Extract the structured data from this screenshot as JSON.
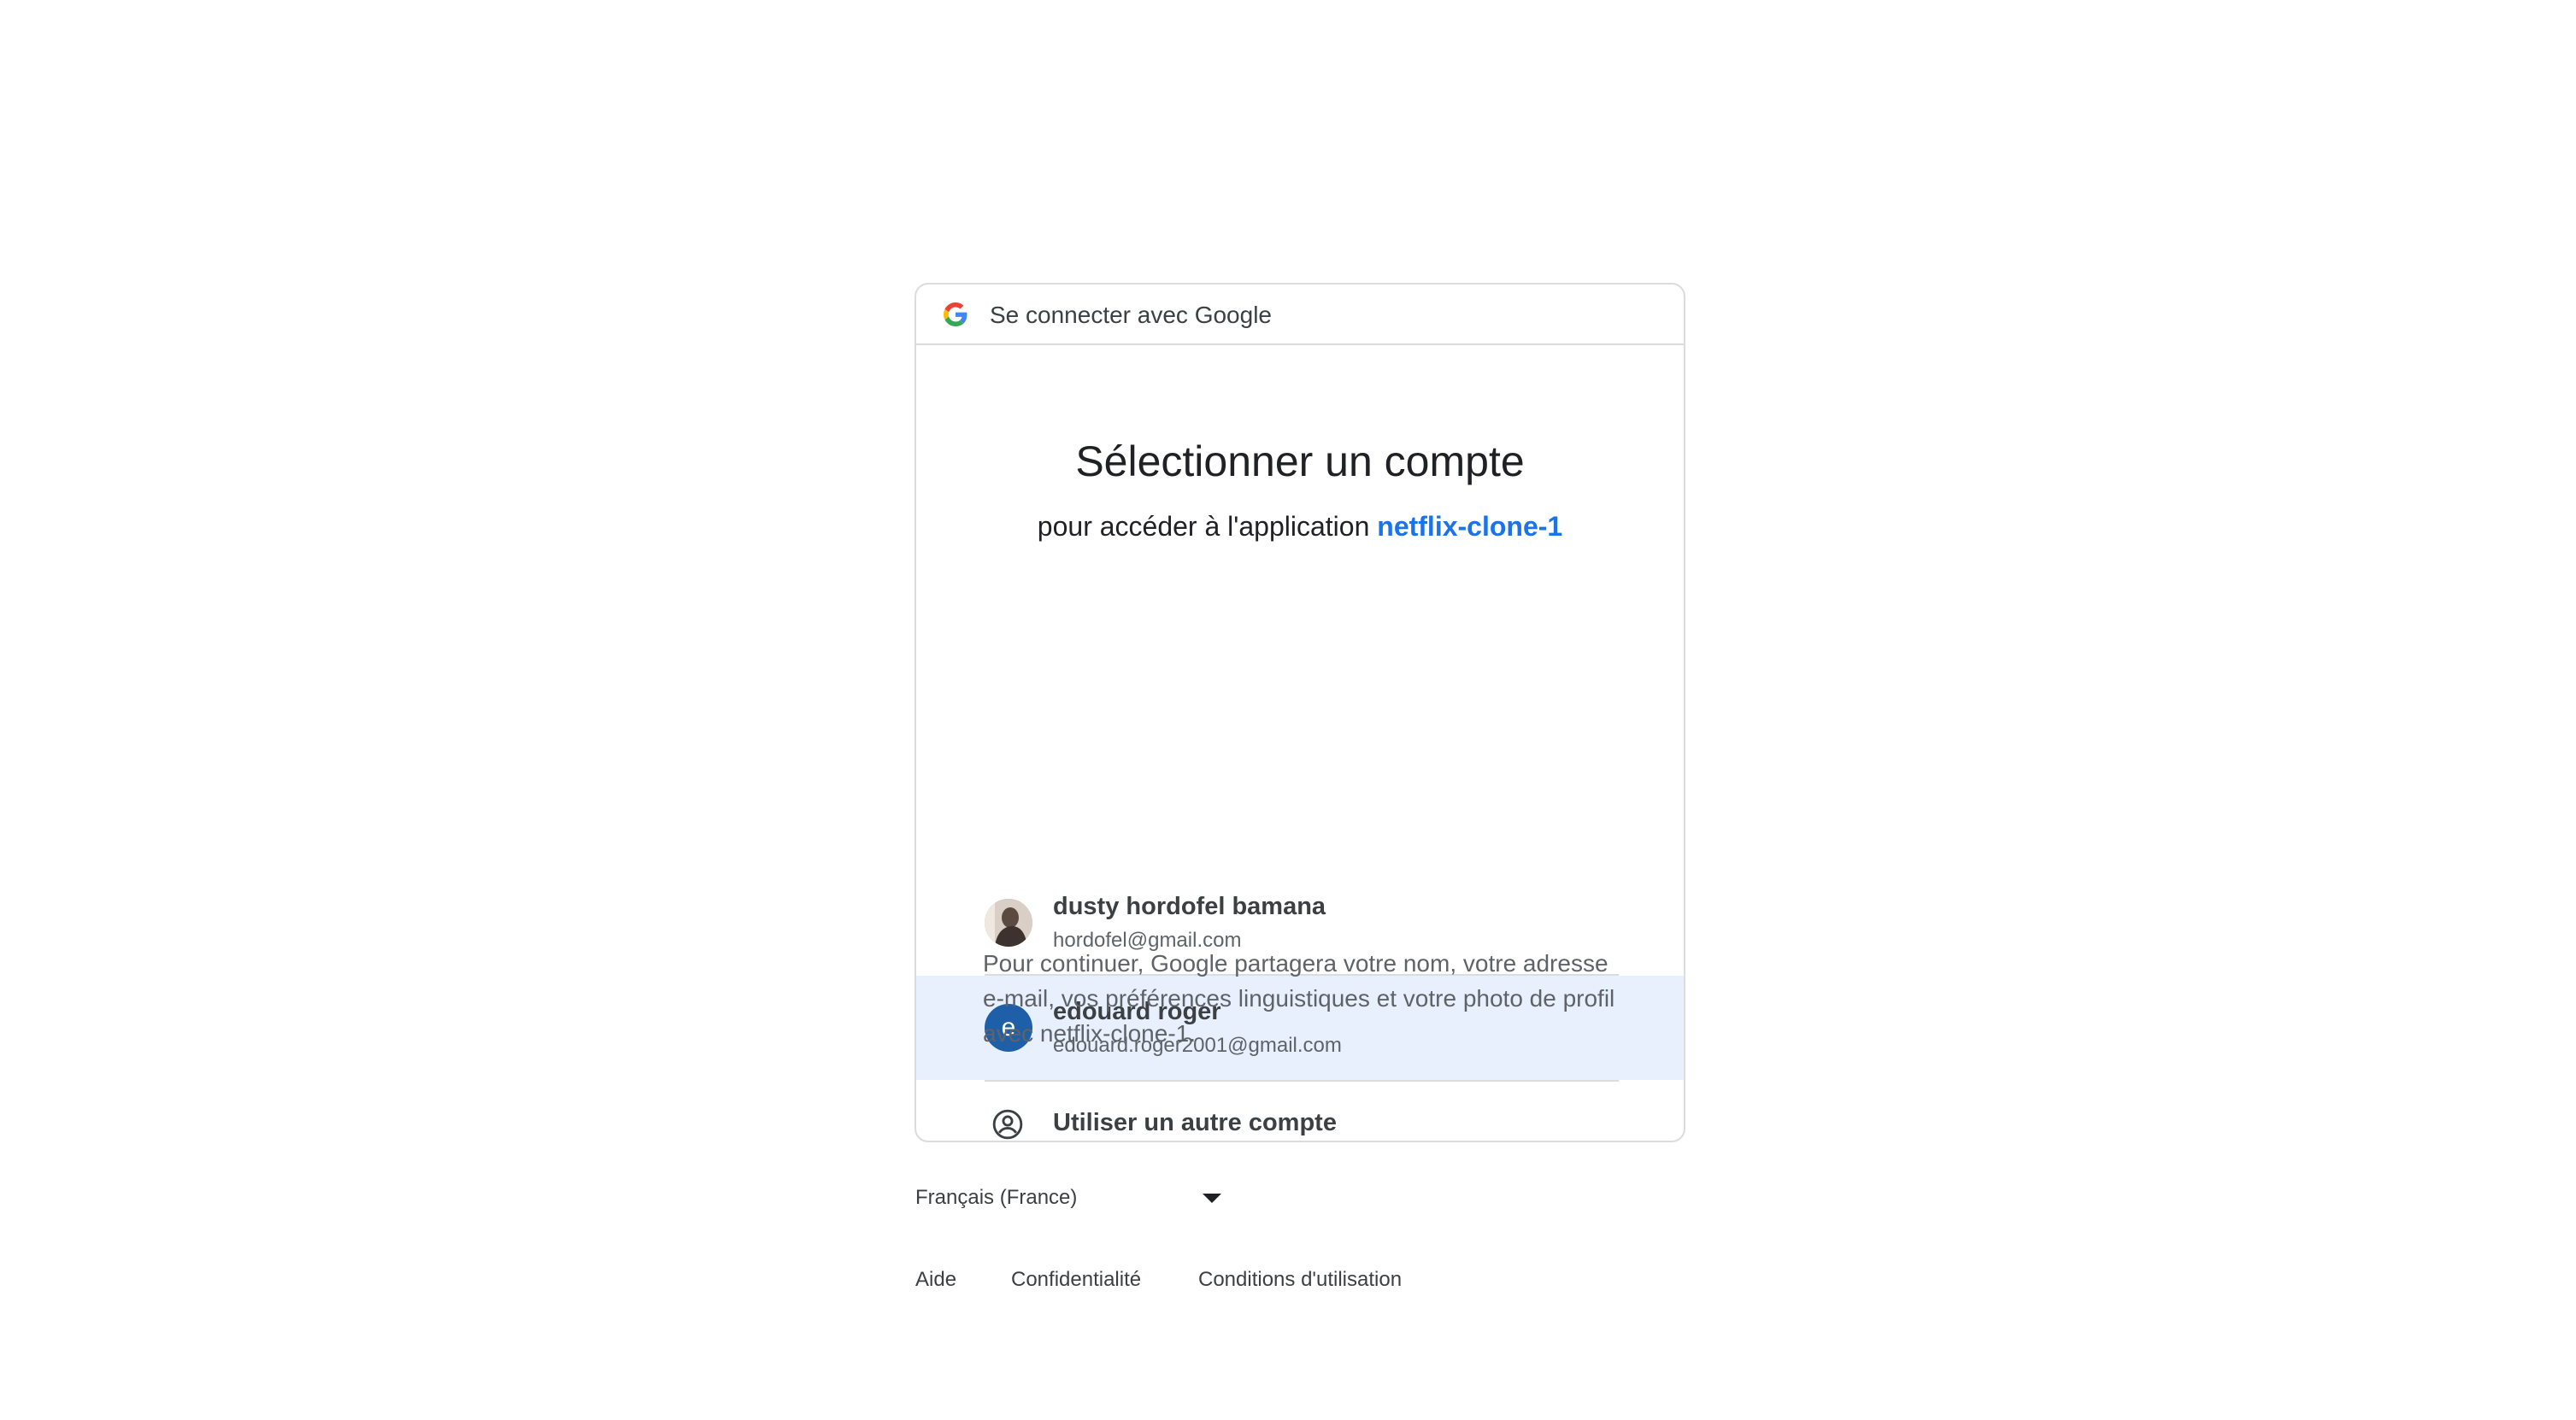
{
  "header": {
    "text": "Se connecter avec Google",
    "logo": "google-g-icon"
  },
  "title": "Sélectionner un compte",
  "subtitle": {
    "prefix": "pour accéder à l'application ",
    "app_name": "netflix-clone-1"
  },
  "accounts": [
    {
      "name": "dusty hordofel bamana",
      "email": "hordofel@gmail.com",
      "avatar": "photo",
      "selected": false
    },
    {
      "name": "edouard roger",
      "email": "edouard.roger2001@gmail.com",
      "avatar_letter": "e",
      "selected": true
    }
  ],
  "other_account": {
    "label": "Utiliser un autre compte",
    "icon": "account-circle-icon"
  },
  "consent_text": "Pour continuer, Google partagera votre nom, votre adresse e-mail, vos préférences linguistiques et votre photo de profil avec netflix-clone-1.",
  "footer": {
    "language": "Français (France)",
    "links": {
      "help": "Aide",
      "privacy": "Confidentialité",
      "terms": "Conditions d'utilisation"
    }
  },
  "colors": {
    "accent": "#1a73e8",
    "selected_bg": "#e8f0fe",
    "avatar_bg": "#1f5fa8",
    "border": "#dadce0"
  }
}
